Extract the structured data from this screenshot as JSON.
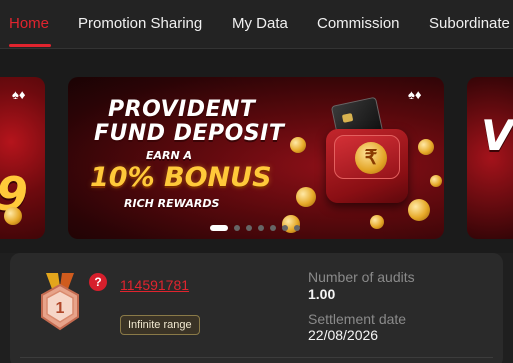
{
  "nav": {
    "tabs": [
      {
        "label": "Home",
        "active": true
      },
      {
        "label": "Promotion Sharing",
        "active": false
      },
      {
        "label": "My Data",
        "active": false
      },
      {
        "label": "Commission",
        "active": false
      },
      {
        "label": "Subordinate",
        "active": false
      }
    ]
  },
  "banner": {
    "line1": "PROVIDENT",
    "line2": "FUND DEPOSIT",
    "line3": "EARN A",
    "line4": "10% BONUS",
    "line5": "RICH REWARDS",
    "rupee_symbol": "₹",
    "left_partial": "9",
    "right_partial": "V",
    "active_slide_index": 0
  },
  "audit": {
    "rank_number": "1",
    "help_symbol": "?",
    "user_id": "114591781",
    "range_badge": "Infinite range",
    "audits_label": "Number of audits",
    "audits_value": "1.00",
    "settlement_label": "Settlement date",
    "settlement_value": "22/08/2026"
  },
  "colors": {
    "accent": "#e0242e",
    "background": "#1f1f1f",
    "panel": "#2a2a2a",
    "gold": "#ffc93a"
  }
}
